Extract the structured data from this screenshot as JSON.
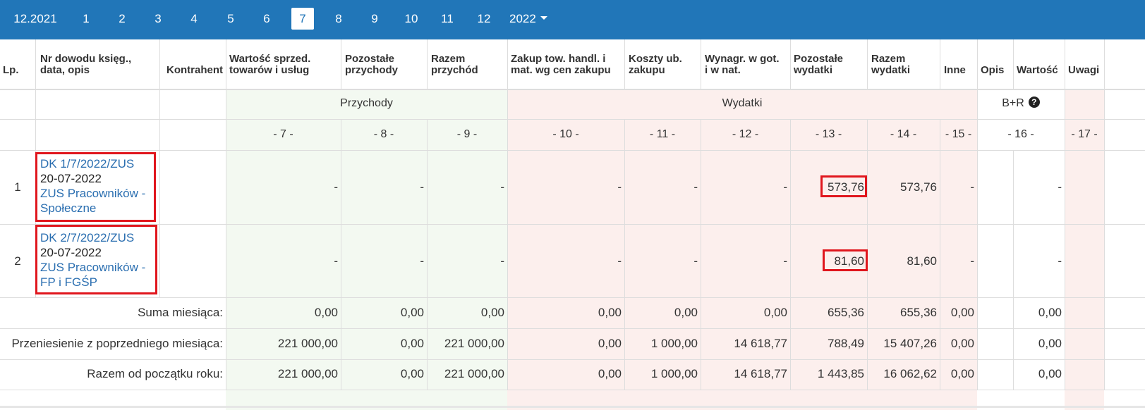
{
  "nav": {
    "items": [
      "12.2021",
      "1",
      "2",
      "3",
      "4",
      "5",
      "6",
      "7",
      "8",
      "9",
      "10",
      "11",
      "12"
    ],
    "active": "7",
    "year": "2022"
  },
  "headers": {
    "lp": "Lp.",
    "nr_line1": "Nr dowodu księg.,",
    "nr_line2": "data, opis",
    "kontrahent": "Kontrahent",
    "c7_line1": "Wartość sprzed.",
    "c7_line2": "towarów i usług",
    "c8_line1": "Pozostałe",
    "c8_line2": "przychody",
    "c9_line1": "Razem",
    "c9_line2": "przychód",
    "c10_line1": "Zakup tow. handl. i",
    "c10_line2": "mat. wg cen zakupu",
    "c11_line1": "Koszty ub.",
    "c11_line2": "zakupu",
    "c12_line1": "Wynagr. w got.",
    "c12_line2": "i w nat.",
    "c13_line1": "Pozostałe",
    "c13_line2": "wydatki",
    "c14_line1": "Razem",
    "c14_line2": "wydatki",
    "inne": "Inne",
    "opis": "Opis",
    "wartosc": "Wartość",
    "uwagi": "Uwagi"
  },
  "groups": {
    "przychody": "Przychody",
    "wydatki": "Wydatki",
    "br": "B+R"
  },
  "column_numbers": [
    "- 7 -",
    "- 8 -",
    "- 9 -",
    "- 10 -",
    "- 11 -",
    "- 12 -",
    "- 13 -",
    "- 14 -",
    "- 15 -",
    "- 16 -",
    "- 17 -"
  ],
  "rows": [
    {
      "lp": "1",
      "doc": "DK 1/7/2022/ZUS",
      "date": "20-07-2022",
      "desc_line1": "ZUS Pracowników -",
      "desc_line2": "Społeczne",
      "c7": "-",
      "c8": "-",
      "c9": "-",
      "c10": "-",
      "c11": "-",
      "c12": "-",
      "c13": "573,76",
      "c14": "573,76",
      "c15": "-",
      "c16": "-"
    },
    {
      "lp": "2",
      "doc": "DK 2/7/2022/ZUS",
      "date": "20-07-2022",
      "desc_line1": "ZUS Pracowników -",
      "desc_line2": "FP i FGŚP",
      "c7": "-",
      "c8": "-",
      "c9": "-",
      "c10": "-",
      "c11": "-",
      "c12": "-",
      "c13": "81,60",
      "c14": "81,60",
      "c15": "-",
      "c16": "-"
    }
  ],
  "summary": [
    {
      "label": "Suma miesiąca:",
      "c7": "0,00",
      "c8": "0,00",
      "c9": "0,00",
      "c10": "0,00",
      "c11": "0,00",
      "c12": "0,00",
      "c13": "655,36",
      "c14": "655,36",
      "c15": "0,00",
      "c16": "0,00"
    },
    {
      "label": "Przeniesienie z poprzedniego miesiąca:",
      "c7": "221 000,00",
      "c8": "0,00",
      "c9": "221 000,00",
      "c10": "0,00",
      "c11": "1 000,00",
      "c12": "14 618,77",
      "c13": "788,49",
      "c14": "15 407,26",
      "c15": "0,00",
      "c16": "0,00"
    },
    {
      "label": "Razem od początku roku:",
      "c7": "221 000,00",
      "c8": "0,00",
      "c9": "221 000,00",
      "c10": "0,00",
      "c11": "1 000,00",
      "c12": "14 618,77",
      "c13": "1 443,85",
      "c14": "16 062,62",
      "c15": "0,00",
      "c16": "0,00"
    }
  ],
  "colors": {
    "nav_bg": "#2176b8",
    "income_bg": "#f3f9f1",
    "expense_bg": "#fcefed",
    "link": "#2a6eb0",
    "highlight": "#e0161d"
  }
}
